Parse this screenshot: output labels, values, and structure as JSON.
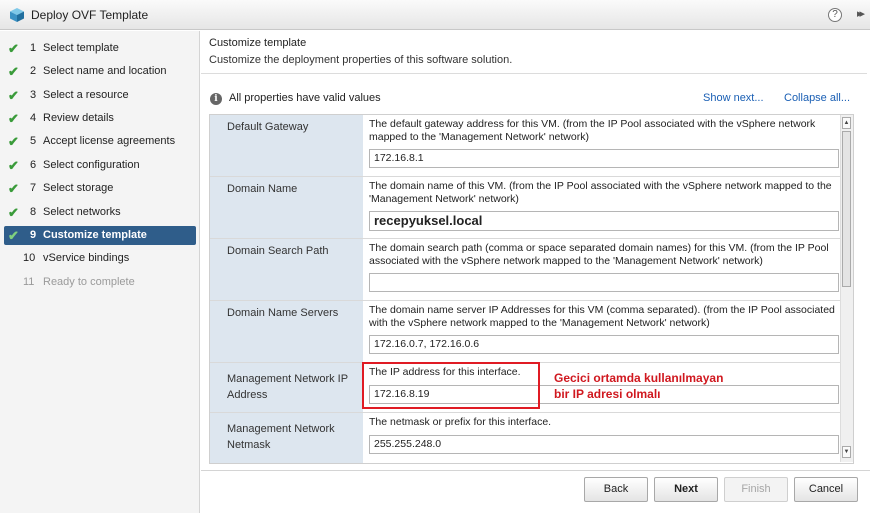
{
  "window": {
    "title": "Deploy OVF Template",
    "help": "?",
    "expand": "▸▸"
  },
  "nav": {
    "steps": [
      {
        "num": "1",
        "label": "Select template",
        "check": "✔"
      },
      {
        "num": "2",
        "label": "Select name and location",
        "check": "✔"
      },
      {
        "num": "3",
        "label": "Select a resource",
        "check": "✔"
      },
      {
        "num": "4",
        "label": "Review details",
        "check": "✔"
      },
      {
        "num": "5",
        "label": "Accept license agreements",
        "check": "✔"
      },
      {
        "num": "6",
        "label": "Select configuration",
        "check": "✔"
      },
      {
        "num": "7",
        "label": "Select storage",
        "check": "✔"
      },
      {
        "num": "8",
        "label": "Select networks",
        "check": "✔"
      },
      {
        "num": "9",
        "label": "Customize template",
        "check": "✔"
      },
      {
        "num": "10",
        "label": "vService bindings",
        "check": ""
      },
      {
        "num": "11",
        "label": "Ready to complete",
        "check": ""
      }
    ]
  },
  "content": {
    "title": "Customize template",
    "subtitle": "Customize the deployment properties of this software solution.",
    "valid_text": "All properties have valid values",
    "show_next": "Show next...",
    "collapse_all": "Collapse all...",
    "info_icon": "i"
  },
  "properties": [
    {
      "key": "Default Gateway",
      "desc": "The default gateway address for this VM. (from the IP Pool associated with the vSphere network mapped to the 'Management Network' network)",
      "value": "172.16.8.1"
    },
    {
      "key": "Domain Name",
      "desc": "The domain name of this VM. (from the IP Pool associated with the vSphere network mapped to the 'Management Network' network)",
      "value": "recepyuksel.local"
    },
    {
      "key": "Domain Search Path",
      "desc": "The domain search path (comma or space separated domain names) for this VM. (from the IP Pool associated with the vSphere network mapped to the 'Management Network' network)",
      "value": ""
    },
    {
      "key": "Domain Name Servers",
      "desc": "The domain name server IP Addresses for this VM (comma separated). (from the IP Pool associated with the vSphere network mapped to the 'Management Network' network)",
      "value": "172.16.0.7, 172.16.0.6"
    },
    {
      "key": "Management Network IP Address",
      "desc": "The IP address for this interface.",
      "value": "172.16.8.19"
    },
    {
      "key": "Management Network Netmask",
      "desc": "The netmask or prefix for this interface.",
      "value": "255.255.248.0"
    }
  ],
  "annotation": {
    "line1": "Gecici ortamda kullanılmayan",
    "line2": "bir  IP adresi olmalı",
    "color": "#e01b24"
  },
  "scroll": {
    "up": "▲",
    "down": "▼"
  },
  "buttons": {
    "back": "Back",
    "next": "Next",
    "finish": "Finish",
    "cancel": "Cancel"
  },
  "colors": {
    "active_step": "#2f5d8a",
    "check": "#3a9b3a",
    "link": "#1a5fb4",
    "key_bg": "#dde6ef"
  }
}
